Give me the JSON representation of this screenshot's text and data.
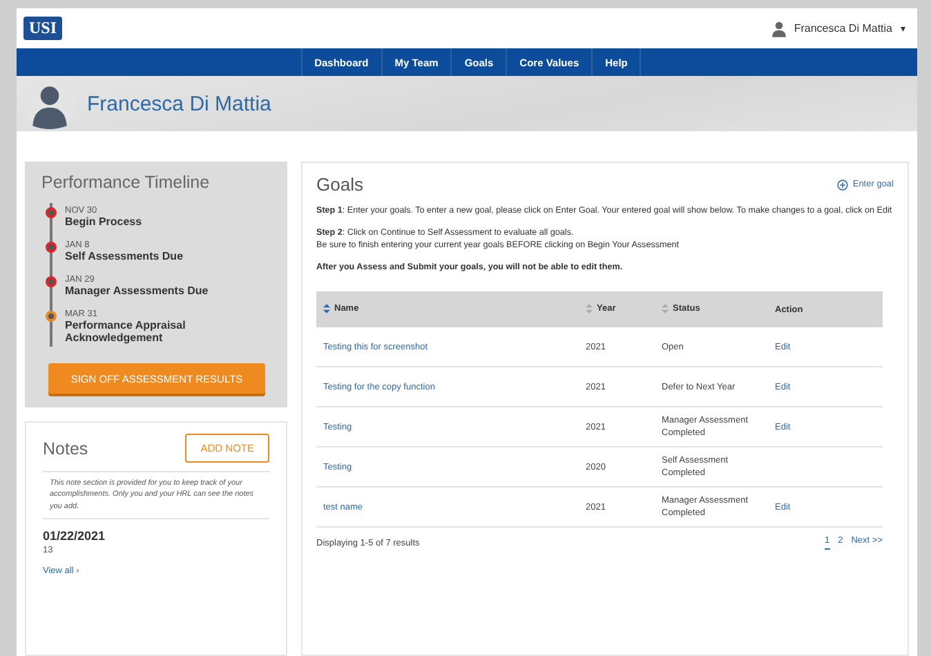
{
  "header": {
    "logo": "USI",
    "user": "Francesca Di Mattia",
    "caret": "▾"
  },
  "nav": [
    "Dashboard",
    "My Team",
    "Goals",
    "Core Values",
    "Help"
  ],
  "banner": {
    "name": "Francesca Di Mattia"
  },
  "timeline": {
    "title": "Performance Timeline",
    "items": [
      {
        "date": "NOV 30",
        "label": "Begin Process",
        "color": "#d9262c"
      },
      {
        "date": "JAN 8",
        "label": "Self Assessments Due",
        "color": "#d9262c"
      },
      {
        "date": "JAN 29",
        "label": "Manager Assessments Due",
        "color": "#d9262c"
      },
      {
        "date": "MAR 31",
        "label": "Performance Appraisal Acknowledgement",
        "color": "#e8892b"
      }
    ],
    "button": "SIGN OFF ASSESSMENT RESULTS"
  },
  "notes": {
    "title": "Notes",
    "button": "ADD NOTE",
    "hint": "This note section is provided for you to keep track of your accomplishments. Only you and your HRL can see the notes you add.",
    "entries": [
      {
        "date": "01/22/2021",
        "text": "13"
      }
    ],
    "view_all": "View all",
    "view_all_arrow": "›"
  },
  "goals": {
    "title": "Goals",
    "enter_goal": "Enter goal",
    "instructions": [
      "**Step 1**: Enter your goals. To enter a new goal, please click on Enter Goal. Your entered goal will show below. To make changes to a goal, click on Edit",
      "**Step 2**: Click on Continue to Self Assessment to evaluate all goals.",
      "Be sure to finish entering your current year goals BEFORE clicking on Begin Your Assessment"
    ],
    "warning": "After you Assess and Submit your goals, you will not be able to edit them.",
    "columns": [
      {
        "label": "Name",
        "sorted": true
      },
      {
        "label": "Year",
        "sorted": false
      },
      {
        "label": "Status",
        "sorted": false
      },
      {
        "label": "Action"
      }
    ],
    "rows": [
      {
        "name": "Testing this for screenshot",
        "year": "2021",
        "status": "Open",
        "action": "Edit"
      },
      {
        "name": "Testing for the copy function",
        "year": "2021",
        "status": "Defer to Next Year",
        "action": "Edit"
      },
      {
        "name": "Testing",
        "year": "2021",
        "status": "Manager Assessment Completed",
        "action": "Edit"
      },
      {
        "name": "Testing",
        "year": "2020",
        "status": "Self Assessment Completed"
      },
      {
        "name": "test name",
        "year": "2021",
        "status": "Manager Assessment Completed",
        "action": "Edit"
      }
    ],
    "summary": "Displaying 1-5 of 7 results",
    "pages": [
      {
        "label": "1",
        "selected": true
      },
      {
        "label": "2",
        "selected": false
      }
    ],
    "next": "Next >>"
  }
}
